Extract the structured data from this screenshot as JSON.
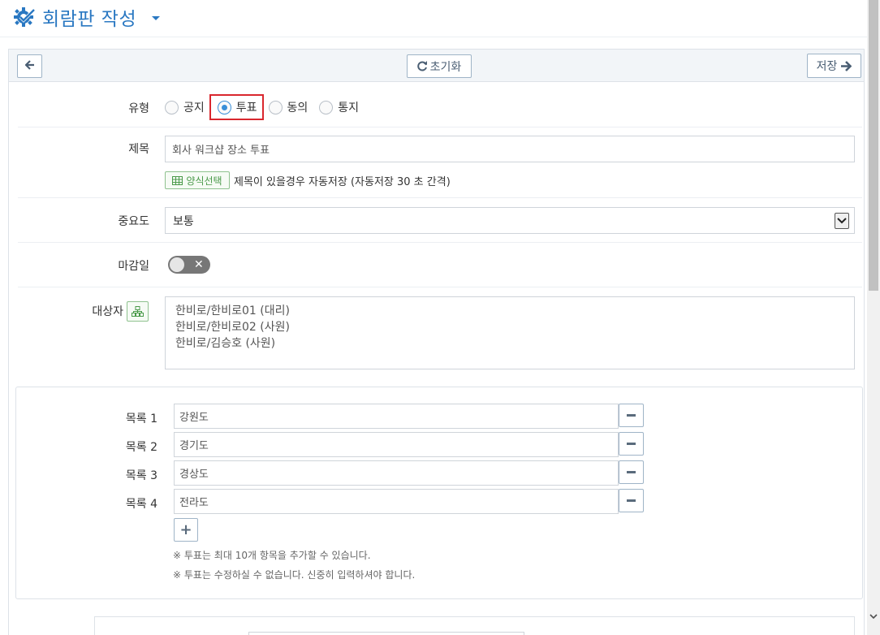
{
  "header": {
    "title": "회람판 작성"
  },
  "toolbar": {
    "reset_label": "초기화",
    "save_label": "저장"
  },
  "form": {
    "type": {
      "label": "유형",
      "options": [
        "공지",
        "투표",
        "동의",
        "통지"
      ],
      "selected": "투표"
    },
    "subject": {
      "label": "제목",
      "value": "회사 워크샵 장소 투표",
      "template_button": "양식선택",
      "autosave_note": "제목이 있을경우 자동저장 (자동저장 30 초 간격)"
    },
    "importance": {
      "label": "중요도",
      "value": "보통"
    },
    "deadline": {
      "label": "마감일",
      "enabled": false
    },
    "targets": {
      "label": "대상자",
      "list": [
        "한비로/한비로01 (대리)",
        "한비로/한비로02 (사원)",
        "한비로/김승호 (사원)"
      ]
    }
  },
  "vote_items": {
    "items": [
      {
        "label": "목록 1",
        "value": "강원도"
      },
      {
        "label": "목록 2",
        "value": "경기도"
      },
      {
        "label": "목록 3",
        "value": "경상도"
      },
      {
        "label": "목록 4",
        "value": "전라도"
      }
    ],
    "notes": [
      "※ 투표는 최대 10개 항목을 추가할 수 있습니다.",
      "※ 투표는 수정하실 수 없습니다. 신중히 입력하셔야 합니다."
    ]
  },
  "colors": {
    "accent": "#2a78c2",
    "radio": "#3a8fd8",
    "highlight": "#d9272e",
    "green": "#4a9a4a"
  }
}
